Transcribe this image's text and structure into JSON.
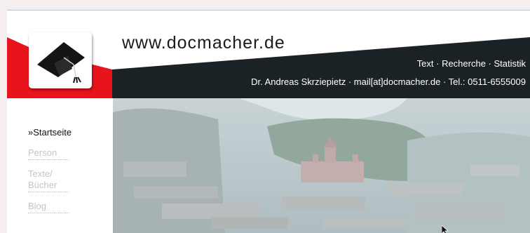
{
  "header": {
    "site_title": "www.docmacher.de",
    "tagline": "Text · Recherche · Statistik",
    "contact": "Dr. Andreas Skrziepietz · mail[at]docmacher.de · Tel.: 0511-6555009"
  },
  "logo": {
    "icon": "graduation-cap-icon"
  },
  "nav": {
    "items": [
      {
        "label": "»Startseite",
        "active": true
      },
      {
        "label": "Person",
        "active": false
      },
      {
        "label": "Texte/\nBücher",
        "active": false
      },
      {
        "label": "Blog",
        "active": false
      }
    ]
  },
  "hero": {
    "description_icon": "city-aerial-photo"
  },
  "colors": {
    "accent_red": "#e8131b",
    "banner_dark": "#1b2226",
    "photo_tint": "#b9c7cc"
  }
}
